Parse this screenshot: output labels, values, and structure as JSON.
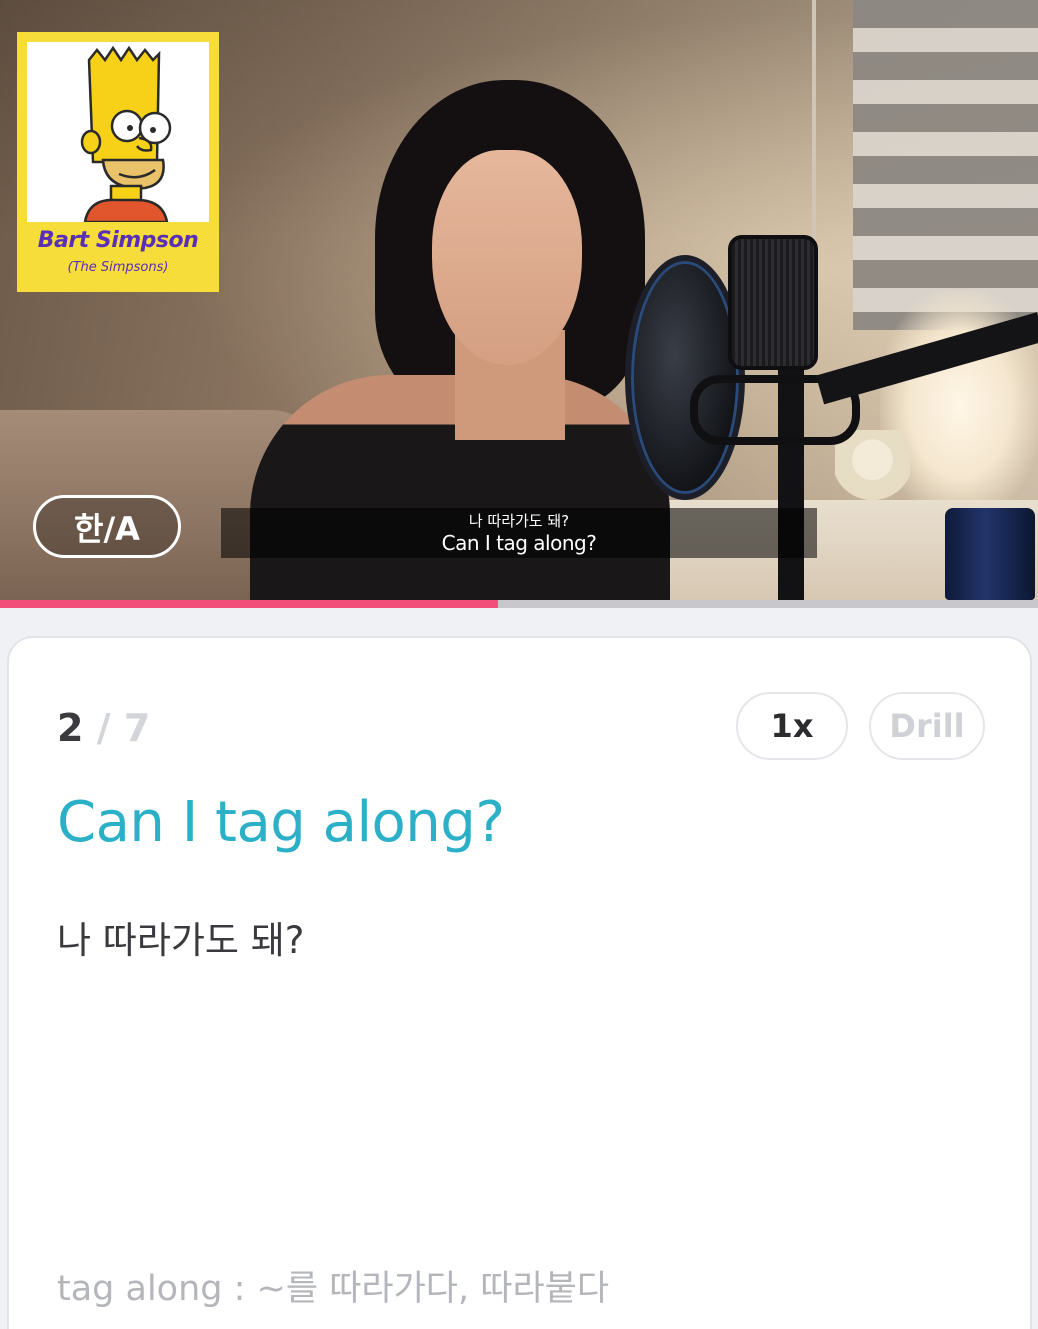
{
  "video": {
    "character_card": {
      "name": "Bart Simpson",
      "show": "(The Simpsons)",
      "background_color": "#f6dd3a",
      "text_color": "#5a2fb8"
    },
    "language_toggle_label": "한/A",
    "subtitle": {
      "korean": "나 따라가도 돼?",
      "english": "Can I tag along?"
    },
    "progress": 0.48,
    "progress_color": "#f2507a"
  },
  "card": {
    "counter": {
      "current": "2",
      "separator": "/",
      "total": "7"
    },
    "speed_label": "1x",
    "drill_label": "Drill",
    "sentence_english": "Can I tag along?",
    "sentence_korean": "나 따라가도 돼?",
    "vocab_note": "tag along : ~를 따라가다, 따라붙다",
    "accent_color": "#2bb0c8"
  }
}
